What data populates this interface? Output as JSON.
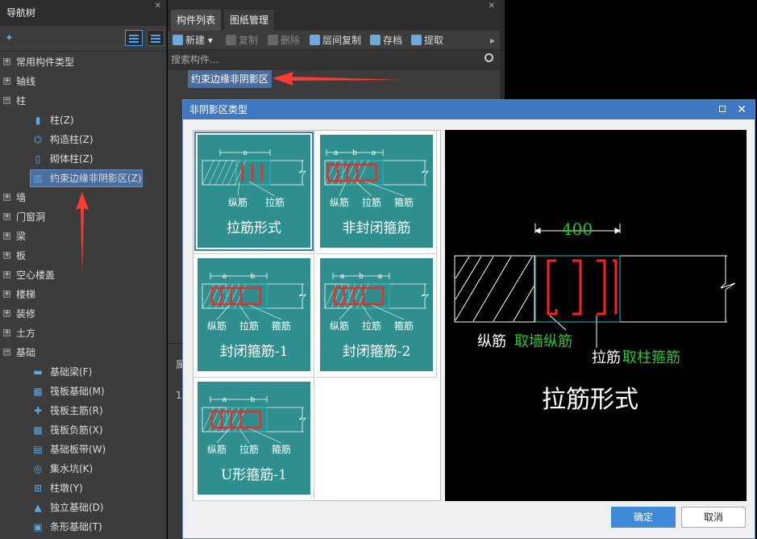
{
  "nav": {
    "title": "导航树",
    "tree": [
      {
        "label": "常用构件类型",
        "expanded": false
      },
      {
        "label": "轴线",
        "expanded": false
      },
      {
        "label": "柱",
        "expanded": true,
        "children": [
          "柱(Z)",
          "构造柱(Z)",
          "砌体柱(Z)",
          "约束边缘非阴影区(Z)"
        ]
      },
      {
        "label": "墙",
        "expanded": false
      },
      {
        "label": "门窗洞",
        "expanded": false
      },
      {
        "label": "梁",
        "expanded": false
      },
      {
        "label": "板",
        "expanded": false
      },
      {
        "label": "空心楼盖",
        "expanded": false
      },
      {
        "label": "楼梯",
        "expanded": false
      },
      {
        "label": "装修",
        "expanded": false
      },
      {
        "label": "土方",
        "expanded": false
      },
      {
        "label": "基础",
        "expanded": true,
        "children": [
          "基础梁(F)",
          "筏板基础(M)",
          "筏板主筋(R)",
          "筏板负筋(X)",
          "基础板带(W)",
          "集水坑(K)",
          "柱墩(Y)",
          "独立基础(D)",
          "条形基础(T)"
        ]
      }
    ]
  },
  "mid": {
    "tabs": [
      "构件列表",
      "图纸管理"
    ],
    "toolbar": {
      "new": "新建",
      "copy": "复制",
      "delete": "删除",
      "floor_copy": "层间复制",
      "save": "存档",
      "extract": "提取"
    },
    "search_placeholder": "搜索构件...",
    "selected_item": "约束边缘非阴影区",
    "lower_row1": "属",
    "lower_row2": "1"
  },
  "dialog": {
    "title": "非阴影区类型",
    "options": [
      {
        "caption": "拉筋形式",
        "labels": [
          "纵筋",
          "拉筋"
        ],
        "dims": [
          "a"
        ]
      },
      {
        "caption": "非封闭箍筋",
        "labels": [
          "纵筋",
          "拉筋",
          "箍筋"
        ],
        "dims": [
          "a",
          "b",
          "a"
        ]
      },
      {
        "caption": "封闭箍筋-1",
        "labels": [
          "纵筋",
          "拉筋",
          "箍筋"
        ],
        "dims": [
          "a",
          "b"
        ]
      },
      {
        "caption": "封闭箍筋-2",
        "labels": [
          "纵筋",
          "拉筋",
          "箍筋"
        ],
        "dims": [
          "a",
          "b",
          "a"
        ]
      },
      {
        "caption": "U形箍筋-1",
        "labels": [
          "纵筋",
          "拉筋",
          "箍筋"
        ],
        "dims": [
          "a",
          "b"
        ]
      }
    ],
    "preview": {
      "dim": "400",
      "label1": "纵筋",
      "label1_note": "取墙纵筋",
      "label2": "拉筋",
      "label2_note": "取柱箍筋",
      "title": "拉筋形式"
    },
    "ok": "确定",
    "cancel": "取消"
  },
  "colors": {
    "accent": "#3f78c0",
    "card": "#2f8f8e",
    "rebar": "#ff2020",
    "annotation": "#22cc22"
  }
}
